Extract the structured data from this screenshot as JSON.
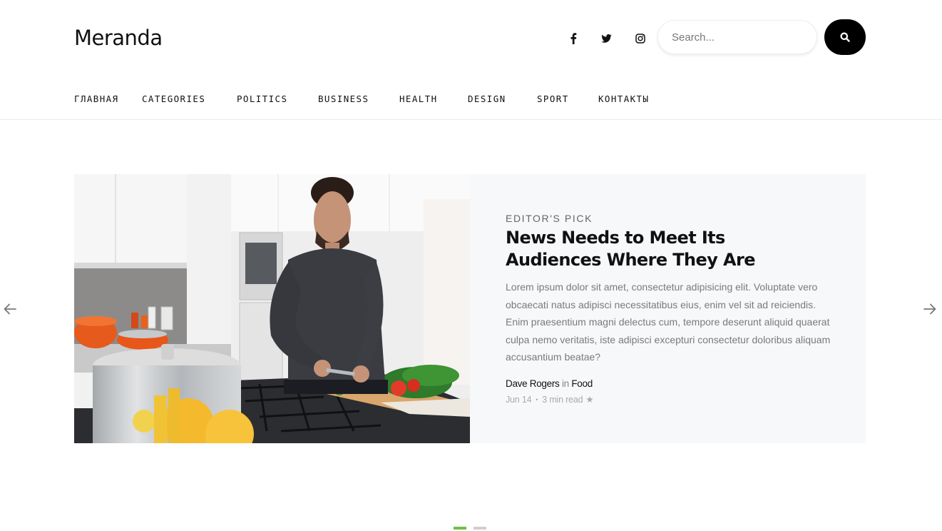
{
  "site": {
    "logo": "Meranda"
  },
  "social": [
    "facebook-icon",
    "twitter-icon",
    "instagram-icon"
  ],
  "search": {
    "placeholder": "Search..."
  },
  "nav": {
    "items": [
      {
        "label": "ГЛАВНАЯ"
      },
      {
        "label": "CATEGORIES"
      },
      {
        "label": "POLITICS"
      },
      {
        "label": "BUSINESS"
      },
      {
        "label": "HEALTH"
      },
      {
        "label": "DESIGN"
      },
      {
        "label": "SPORT"
      },
      {
        "label": "КОНТАКТЫ"
      }
    ]
  },
  "featured": {
    "kicker": "EDITOR'S PICK",
    "headline": "News Needs to Meet Its Audiences Where They Are",
    "excerpt": "Lorem ipsum dolor sit amet, consectetur adipisicing elit. Voluptate vero obcaecati natus adipisci necessitatibus eius, enim vel sit ad reiciendis. Enim praesentium magni delectus cum, tempore deserunt aliquid quaerat culpa nemo veritatis, iste adipisci excepturi consectetur doloribus aliquam accusantium beatae?",
    "author": "Dave Rogers",
    "in_word": "in",
    "category": "Food",
    "date": "Jun 14",
    "separator": "•",
    "read_time": "3 min read",
    "star": "★"
  },
  "slider": {
    "total_pages": 2,
    "active_page": 1,
    "active_color": "#6cc04a",
    "inactive_color": "#cfcfcf"
  },
  "colors": {
    "accent": "#000000",
    "panel_bg": "#f7f8f9",
    "muted_text": "#7a7a7a"
  }
}
